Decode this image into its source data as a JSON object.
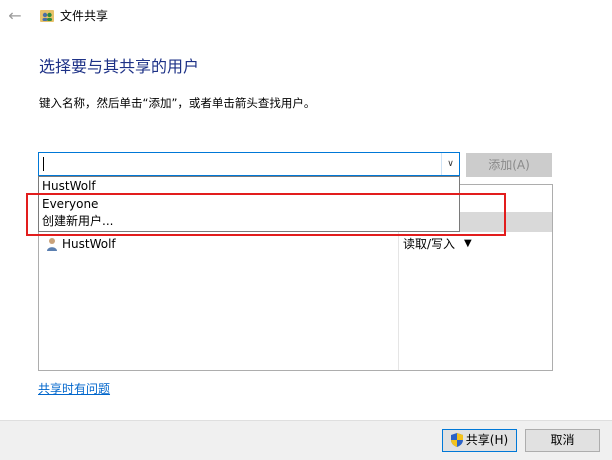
{
  "window": {
    "title": "文件共享"
  },
  "heading": "选择要与其共享的用户",
  "instruction": "键入名称，然后单击“添加”，或者单击箭头查找用户。",
  "name_field": {
    "value": ""
  },
  "add_button": {
    "label": "添加(A)",
    "enabled": false
  },
  "dropdown": {
    "items": [
      "HustWolf",
      "Everyone",
      "创建新用户..."
    ]
  },
  "permissions": {
    "rows": [
      {
        "user": "HustWolf",
        "level": "读取/写入"
      }
    ]
  },
  "help_link": "共享时有问题",
  "footer": {
    "share_label": "共享(H)",
    "cancel_label": "取消"
  },
  "colors": {
    "heading": "#1e3287",
    "link": "#0066cc",
    "focus": "#0078d7",
    "highlight": "#e21d1d"
  },
  "icons": {
    "back": "back-arrow-icon",
    "app": "people-share-icon",
    "user": "user-icon",
    "shield": "uac-shield-icon"
  }
}
